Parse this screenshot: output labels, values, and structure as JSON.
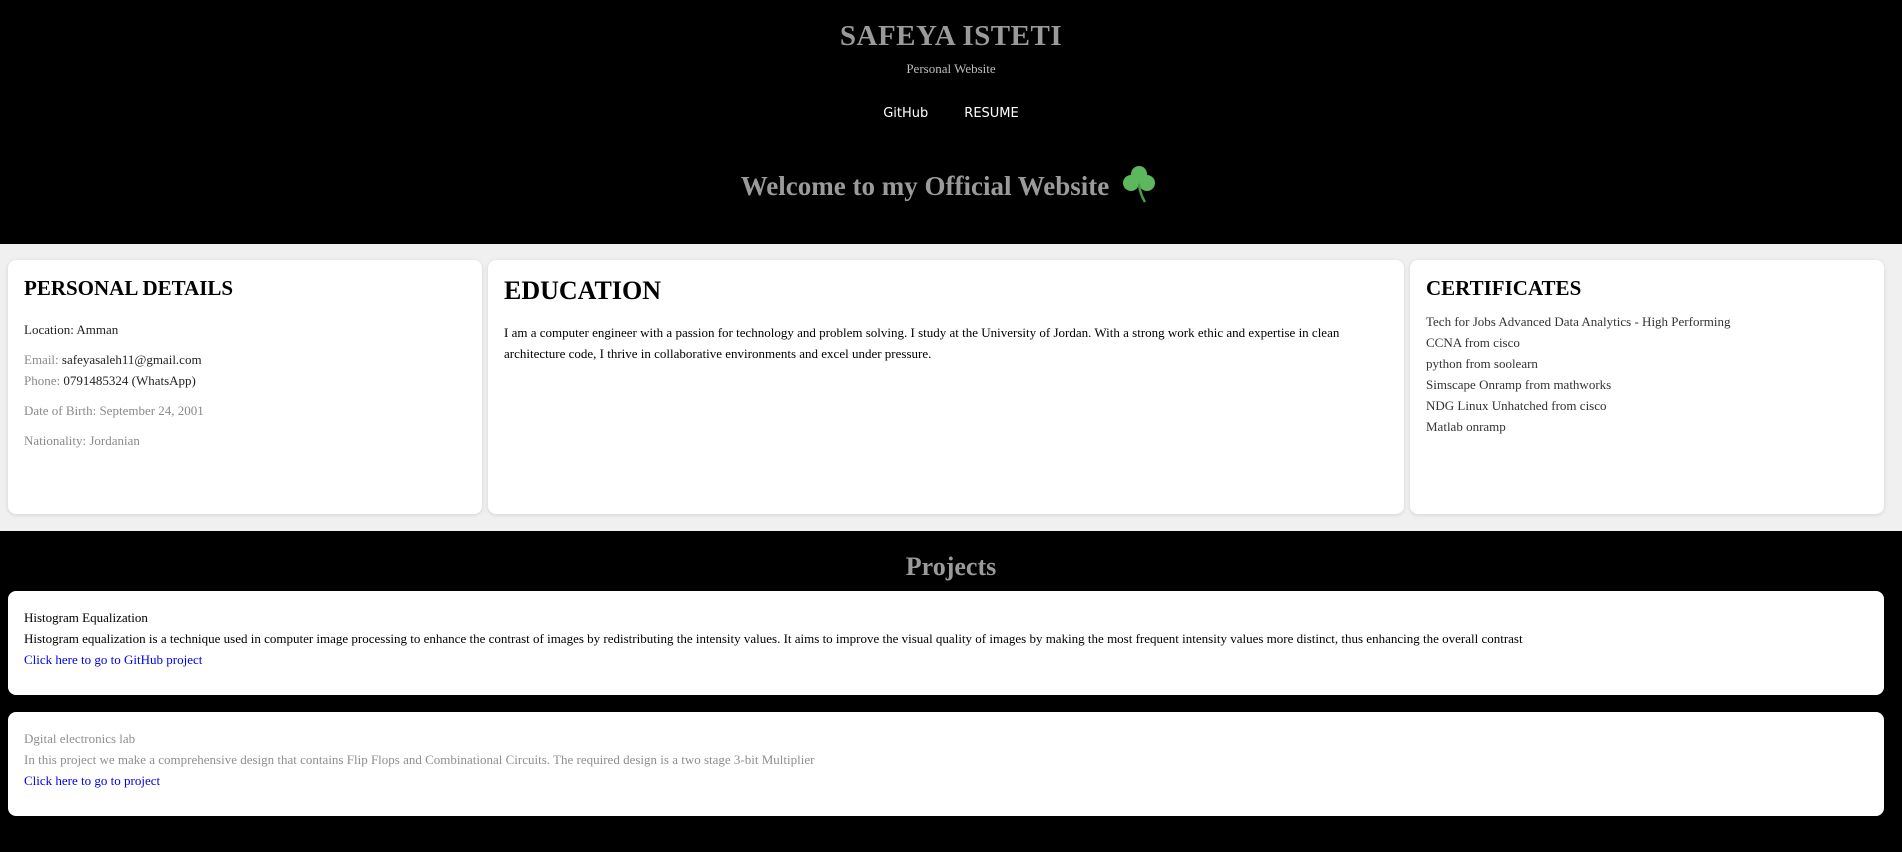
{
  "header": {
    "title": "SAFEYA ISTETI",
    "subtitle": "Personal Website",
    "nav": [
      {
        "label": "GitHub"
      },
      {
        "label": "RESUME"
      }
    ],
    "welcome": "Welcome to my Official Website",
    "welcome_icon": "shamrock-icon"
  },
  "personal": {
    "heading": "PERSONAL DETAILS",
    "location": "Location: Amman",
    "email_label": "Email:",
    "email_value": "safeyasaleh11@gmail.com",
    "phone_label": "Phone:",
    "phone_value": "0791485324 (WhatsApp)",
    "dob": "Date of Birth: September 24, 2001",
    "nationality": "Nationality: Jordanian"
  },
  "education": {
    "heading": "EDUCATION",
    "text": "I am a computer engineer with a passion for technology and problem solving. I study at the University of Jordan. With a strong work ethic and expertise in clean architecture code, I thrive in collaborative environments and excel under pressure."
  },
  "certificates": {
    "heading": "CERTIFICATES",
    "items": [
      "Tech for Jobs Advanced Data Analytics - High Performing",
      "CCNA from cisco",
      "python from soolearn",
      "Simscape Onramp from mathworks",
      "NDG Linux Unhatched from cisco",
      "Matlab onramp"
    ]
  },
  "projects": {
    "heading": "Projects",
    "items": [
      {
        "title": "Histogram Equalization",
        "description": "Histogram equalization is a technique used in computer image processing to enhance the contrast of images by redistributing the intensity values. It aims to improve the visual quality of images by making the most frequent intensity values more distinct, thus enhancing the overall contrast",
        "link": "Click here to go to GitHub project"
      },
      {
        "title": "Dgital electronics lab",
        "description": "In this project we make a comprehensive design that contains Flip Flops and Combinational Circuits. The required design is a two stage 3-bit Multiplier",
        "link": "Click here to go to project"
      }
    ]
  },
  "colors": {
    "header_bg": "#000000",
    "band_bg": "#f0f0f0",
    "title_gray": "#9a9a9a",
    "link_blue": "#0000ee",
    "clover_green": "#5cb85c"
  }
}
